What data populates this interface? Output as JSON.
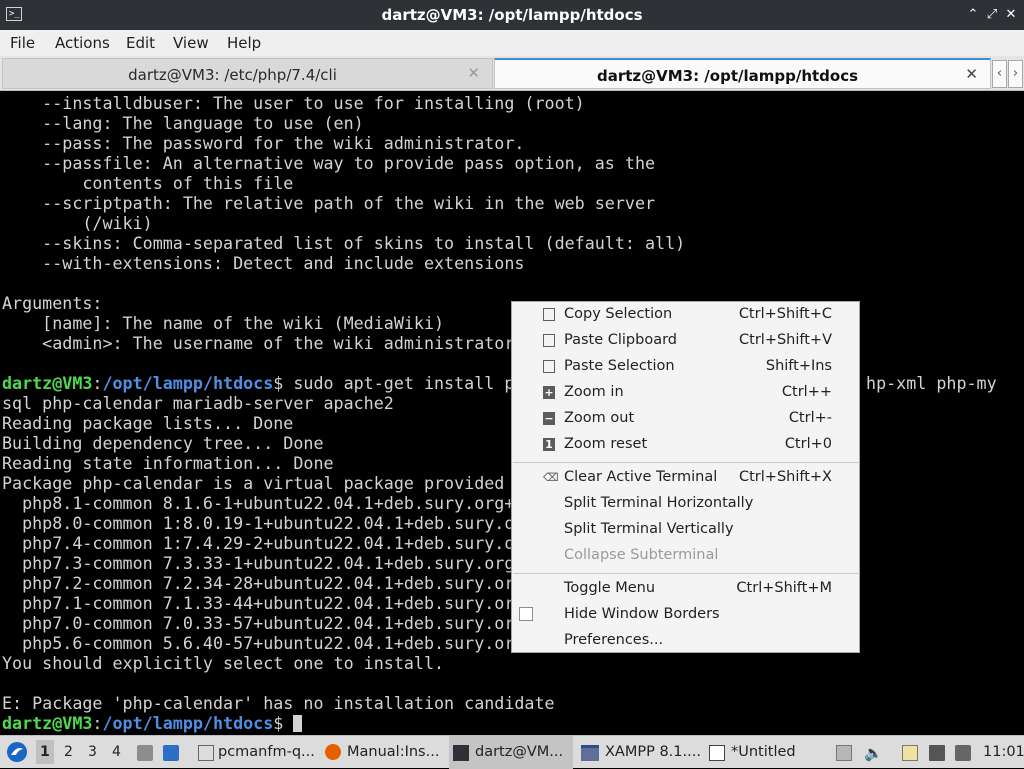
{
  "window": {
    "title": "dartz@VM3: /opt/lampp/htdocs",
    "app_icon_glyph": ">_",
    "buttons": {
      "minimize": "⌃",
      "restore": "⤢",
      "close": "✕"
    }
  },
  "menubar": [
    "File",
    "Actions",
    "Edit",
    "View",
    "Help"
  ],
  "tabs": [
    {
      "label": "dartz@VM3: /etc/php/7.4/cli",
      "close": "✕",
      "active": false
    },
    {
      "label": "dartz@VM3: /opt/lampp/htdocs",
      "close": "✕",
      "active": true
    }
  ],
  "tab_nav": {
    "prev": "‹",
    "next": "›"
  },
  "terminal": {
    "lines": [
      "    --installdbuser: The user to use for installing (root)",
      "    --lang: The language to use (en)",
      "    --pass: The password for the wiki administrator.",
      "    --passfile: An alternative way to provide pass option, as the",
      "        contents of this file",
      "    --scriptpath: The relative path of the wiki in the web server",
      "        (/wiki)",
      "    --skins: Comma-separated list of skins to install (default: all)",
      "    --with-extensions: Detect and include extensions",
      "",
      "Arguments:",
      "    [name]: The name of the wiki (MediaWiki)",
      "    <admin>: The username of the wiki administrator",
      ""
    ],
    "prompt": {
      "user": "dartz@VM3",
      "sep": ":",
      "path": "/opt/lampp/htdocs",
      "sym": "$"
    },
    "command_visible_start": " sudo apt-get install p",
    "command_visible_end": "hp-xml php-my",
    "lines_after": [
      "sql php-calendar mariadb-server apache2",
      "Reading package lists... Done",
      "Building dependency tree... Done",
      "Reading state information... Done",
      "Package php-calendar is a virtual package provided",
      "  php8.1-common 8.1.6-1+ubuntu22.04.1+deb.sury.org+",
      "  php8.0-common 1:8.0.19-1+ubuntu22.04.1+deb.sury.o",
      "  php7.4-common 1:7.4.29-2+ubuntu22.04.1+deb.sury.o",
      "  php7.3-common 7.3.33-1+ubuntu22.04.1+deb.sury.org",
      "  php7.2-common 7.2.34-28+ubuntu22.04.1+deb.sury.or",
      "  php7.1-common 7.1.33-44+ubuntu22.04.1+deb.sury.or",
      "  php7.0-common 7.0.33-57+ubuntu22.04.1+deb.sury.or",
      "  php5.6-common 5.6.40-57+ubuntu22.04.1+deb.sury.or",
      "You should explicitly select one to install.",
      "",
      "E: Package 'php-calendar' has no installation candidate"
    ]
  },
  "context_menu": {
    "items": [
      {
        "label": "Copy Selection",
        "shortcut": "Ctrl+Shift+C",
        "icon": "copy-icon"
      },
      {
        "label": "Paste Clipboard",
        "shortcut": "Ctrl+Shift+V",
        "icon": "paste-icon"
      },
      {
        "label": "Paste Selection",
        "shortcut": "Shift+Ins",
        "icon": "paste-icon"
      },
      {
        "label": "Zoom in",
        "shortcut": "Ctrl++",
        "icon": "zoom-in-icon"
      },
      {
        "label": "Zoom out",
        "shortcut": "Ctrl+-",
        "icon": "zoom-out-icon"
      },
      {
        "label": "Zoom reset",
        "shortcut": "Ctrl+0",
        "icon": "zoom-reset-icon"
      },
      {
        "label": "Clear Active Terminal",
        "shortcut": "Ctrl+Shift+X",
        "icon": "clear-icon"
      },
      {
        "label": "Split Terminal Horizontally",
        "shortcut": ""
      },
      {
        "label": "Split Terminal Vertically",
        "shortcut": ""
      },
      {
        "label": "Collapse Subterminal",
        "shortcut": "",
        "disabled": true
      },
      {
        "label": "Toggle Menu",
        "shortcut": "Ctrl+Shift+M"
      },
      {
        "label": "Hide Window Borders",
        "shortcut": "",
        "checkbox": false
      },
      {
        "label": "Preferences...",
        "shortcut": ""
      }
    ]
  },
  "taskbar": {
    "workspaces": [
      "1",
      "2",
      "3",
      "4"
    ],
    "tasks": [
      {
        "label": "pcmanfm-q...",
        "icon": "file-manager-icon"
      },
      {
        "label": "Manual:Ins...",
        "icon": "firefox-icon"
      },
      {
        "label": "dartz@VM...",
        "icon": "terminal-icon",
        "active": true
      },
      {
        "label": "XAMPP 8.1....",
        "icon": "window-icon"
      },
      {
        "label": "*Untitled",
        "icon": "text-editor-icon"
      }
    ],
    "clock": "11:01"
  }
}
